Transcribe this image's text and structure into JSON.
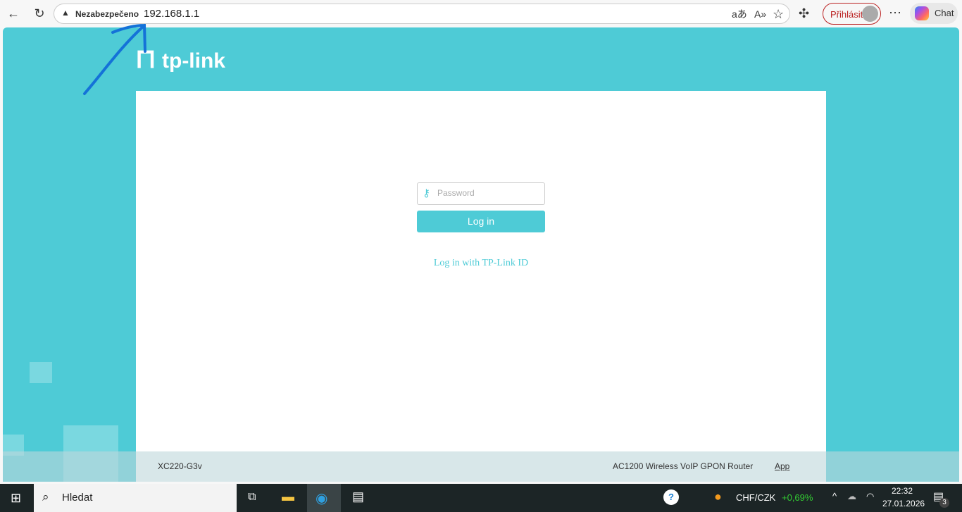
{
  "browser": {
    "security_label": "Nezabezpečeno",
    "url": "192.168.1.1",
    "signin_label": "Přihlásit",
    "chat_label": "Chat"
  },
  "page": {
    "logo_text": "tp-link",
    "password_placeholder": "Password",
    "login_label": "Log in",
    "tplink_id_link": "Log in with TP-Link ID",
    "model": "XC220-G3v",
    "description": "AC1200 Wireless VoIP GPON Router",
    "app_link": "App",
    "brand_color": "#4ecbd6"
  },
  "taskbar": {
    "search_label": "Hledat",
    "ticker": "CHF/CZK",
    "ticker_change": "+0,69%",
    "time": "22:32",
    "date": "27.01.2026",
    "notifications": "3"
  }
}
